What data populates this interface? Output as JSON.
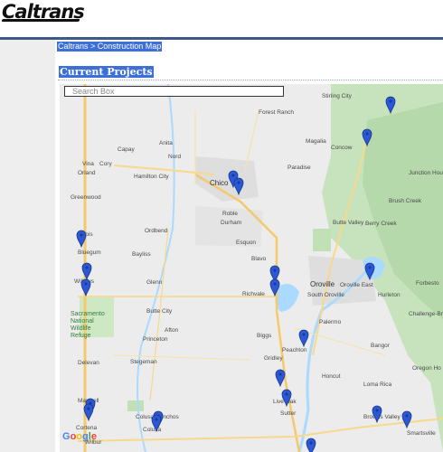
{
  "header": {
    "logo_text": "Caltrans"
  },
  "breadcrumb": "Caltrans > Construction Map",
  "section_title": "Current Projects",
  "search": {
    "placeholder": "Search Box",
    "value": ""
  },
  "map": {
    "attribution": "Google",
    "colors": {
      "water": "#aadaff",
      "green": "#cfe8c4",
      "forest": "#b9dcb0",
      "road": "#f8d88a",
      "urban": "#dcdcdc",
      "pin": "#2c57d6"
    },
    "places": [
      {
        "id": "stirling-city",
        "name": "Stirling City"
      },
      {
        "id": "forest-ranch",
        "name": "Forest Ranch"
      },
      {
        "id": "anita",
        "name": "Anita"
      },
      {
        "id": "magalia",
        "name": "Magalia"
      },
      {
        "id": "capay",
        "name": "Capay"
      },
      {
        "id": "concow",
        "name": "Concow"
      },
      {
        "id": "nord",
        "name": "Nord"
      },
      {
        "id": "vina-area",
        "name": "Vina"
      },
      {
        "id": "cory",
        "name": "Cory"
      },
      {
        "id": "orland",
        "name": "Orland"
      },
      {
        "id": "hamilton-city",
        "name": "Hamilton City"
      },
      {
        "id": "chico",
        "name": "Chico"
      },
      {
        "id": "paradise",
        "name": "Paradise"
      },
      {
        "id": "junction-house",
        "name": "Junction House"
      },
      {
        "id": "greenwood",
        "name": "Greenwood"
      },
      {
        "id": "brush-creek",
        "name": "Brush Creek"
      },
      {
        "id": "roble",
        "name": "Roble"
      },
      {
        "id": "durham",
        "name": "Durham"
      },
      {
        "id": "butte-valley",
        "name": "Butte Valley"
      },
      {
        "id": "berry-creek",
        "name": "Berry Creek"
      },
      {
        "id": "ordbend",
        "name": "Ordbend"
      },
      {
        "id": "esquon",
        "name": "Esquon"
      },
      {
        "id": "artois",
        "name": "Artois"
      },
      {
        "id": "bluegum",
        "name": "Bluegum"
      },
      {
        "id": "bayliss",
        "name": "Bayliss"
      },
      {
        "id": "blavo",
        "name": "Blavo"
      },
      {
        "id": "willows",
        "name": "Willows"
      },
      {
        "id": "glenn",
        "name": "Glenn"
      },
      {
        "id": "richvale",
        "name": "Richvale"
      },
      {
        "id": "oroville",
        "name": "Oroville"
      },
      {
        "id": "oroville-east",
        "name": "Oroville East"
      },
      {
        "id": "south-oroville",
        "name": "South Oroville"
      },
      {
        "id": "hurleton",
        "name": "Hurleton"
      },
      {
        "id": "forbestown",
        "name": "Forbesto"
      },
      {
        "id": "butte-city",
        "name": "Butte City"
      },
      {
        "id": "palermo",
        "name": "Palermo"
      },
      {
        "id": "challenge",
        "name": "Challenge-Brownsv"
      },
      {
        "id": "afton",
        "name": "Afton"
      },
      {
        "id": "princeton",
        "name": "Princeton"
      },
      {
        "id": "biggs",
        "name": "Biggs"
      },
      {
        "id": "peachton",
        "name": "Peachton"
      },
      {
        "id": "bangor",
        "name": "Bangor"
      },
      {
        "id": "gridley",
        "name": "Gridley"
      },
      {
        "id": "delevan",
        "name": "Delevan"
      },
      {
        "id": "stegeman",
        "name": "Stegeman"
      },
      {
        "id": "oregon-house",
        "name": "Oregon Ho"
      },
      {
        "id": "honcut",
        "name": "Honcut"
      },
      {
        "id": "live-oak",
        "name": "Live Oak"
      },
      {
        "id": "loma-rica",
        "name": "Loma Rica"
      },
      {
        "id": "maxwell",
        "name": "Maxwell"
      },
      {
        "id": "colusa-ranchos",
        "name": "Colusa Ranchos"
      },
      {
        "id": "sutter",
        "name": "Sutter"
      },
      {
        "id": "browns-valley",
        "name": "Browns Valley"
      },
      {
        "id": "smartsville",
        "name": "Smartsville"
      },
      {
        "id": "cortena",
        "name": "Cortena"
      },
      {
        "id": "colusa",
        "name": "Colusa"
      },
      {
        "id": "wilbur",
        "name": "Wilbur"
      }
    ],
    "refuge_label": [
      "Sacramento",
      "National",
      "Wildlife",
      "Refuge"
    ],
    "pin_count": 20
  }
}
